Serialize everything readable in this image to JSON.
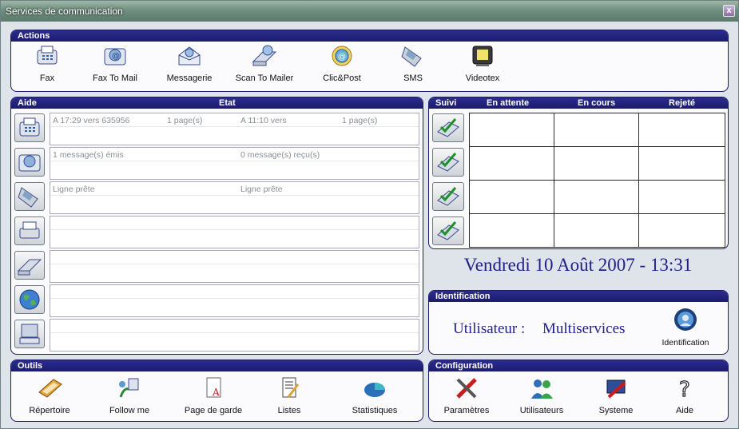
{
  "window": {
    "title": "Services de communication",
    "close": "x"
  },
  "actions": {
    "header": "Actions",
    "items": [
      {
        "label": "Fax",
        "icon": "fax-icon"
      },
      {
        "label": "Fax To Mail",
        "icon": "fax-to-mail-icon"
      },
      {
        "label": "Messagerie",
        "icon": "messagerie-icon"
      },
      {
        "label": "Scan To Mailer",
        "icon": "scan-to-mailer-icon"
      },
      {
        "label": "Clic&Post",
        "icon": "clic-post-icon"
      },
      {
        "label": "SMS",
        "icon": "sms-icon"
      },
      {
        "label": "Videotex",
        "icon": "videotex-icon"
      }
    ]
  },
  "status": {
    "aide_header": "Aide",
    "etat_header": "Etat",
    "rows": [
      {
        "icon": "fax-icon",
        "a": "A 17:29 vers 635956",
        "b": "1 page(s)",
        "c": "A 11:10 vers",
        "d": "1 page(s)"
      },
      {
        "icon": "fax-to-mail-icon",
        "a": "1 message(s) émis",
        "b": "",
        "c": "0 message(s) reçu(s)",
        "d": ""
      },
      {
        "icon": "sms-icon",
        "a": "Ligne prête",
        "b": "",
        "c": "Ligne prête",
        "d": ""
      },
      {
        "icon": "printer-icon",
        "a": "",
        "b": "",
        "c": "",
        "d": ""
      },
      {
        "icon": "scanner-icon",
        "a": "",
        "b": "",
        "c": "",
        "d": ""
      },
      {
        "icon": "globe-icon",
        "a": "",
        "b": "",
        "c": "",
        "d": ""
      },
      {
        "icon": "terminal-icon",
        "a": "",
        "b": "",
        "c": "",
        "d": ""
      }
    ]
  },
  "suivi": {
    "headers": [
      "Suivi",
      "En attente",
      "En cours",
      "Rejeté"
    ],
    "rows": 4
  },
  "date": "Vendredi 10 Août 2007 - 13:31",
  "identification": {
    "header": "Identification",
    "user_label": "Utilisateur :",
    "user_value": "Multiservices",
    "button": "Identification"
  },
  "outils": {
    "header": "Outils",
    "items": [
      {
        "label": "Répertoire",
        "icon": "notebook-icon"
      },
      {
        "label": "Follow me",
        "icon": "follow-me-icon"
      },
      {
        "label": "Page de garde",
        "icon": "page-de-garde-icon"
      },
      {
        "label": "Listes",
        "icon": "listes-icon"
      },
      {
        "label": "Statistiques",
        "icon": "pie-chart-icon"
      }
    ]
  },
  "configuration": {
    "header": "Configuration",
    "items": [
      {
        "label": "Paramètres",
        "icon": "tools-icon"
      },
      {
        "label": "Utilisateurs",
        "icon": "users-icon"
      },
      {
        "label": "Systeme",
        "icon": "system-icon"
      },
      {
        "label": "Aide",
        "icon": "help-icon"
      }
    ]
  }
}
